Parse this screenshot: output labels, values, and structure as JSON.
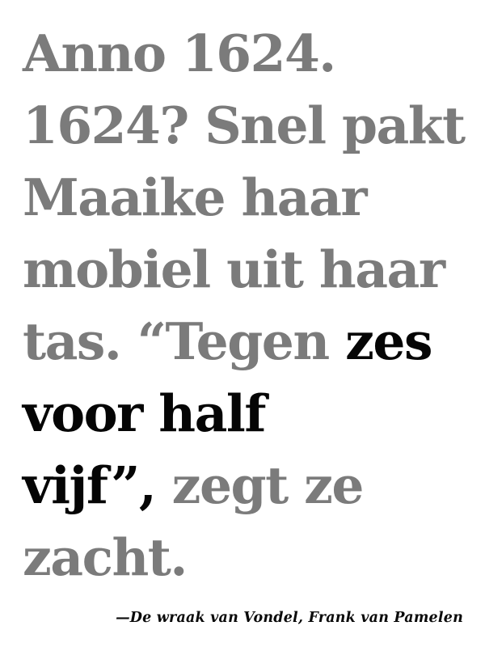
{
  "quote": {
    "line1": "Anno 1624.",
    "line2": "1624? Snel pakt",
    "line3": "Maaike haar",
    "line4": "mobiel uit haar",
    "line5_plain": "tas. “Tegen ",
    "line5_bold": "zes",
    "line6_bold": "voor half",
    "line7_bold": "vijf”,",
    "line7_plain": " zegt ze",
    "line8": "zacht."
  },
  "attribution": "—De wraak van Vondel, Frank van Pamelen",
  "colors": {
    "background": "#ffffff",
    "muted_text": "#7b7b7b",
    "emphasis_text": "#050505"
  }
}
